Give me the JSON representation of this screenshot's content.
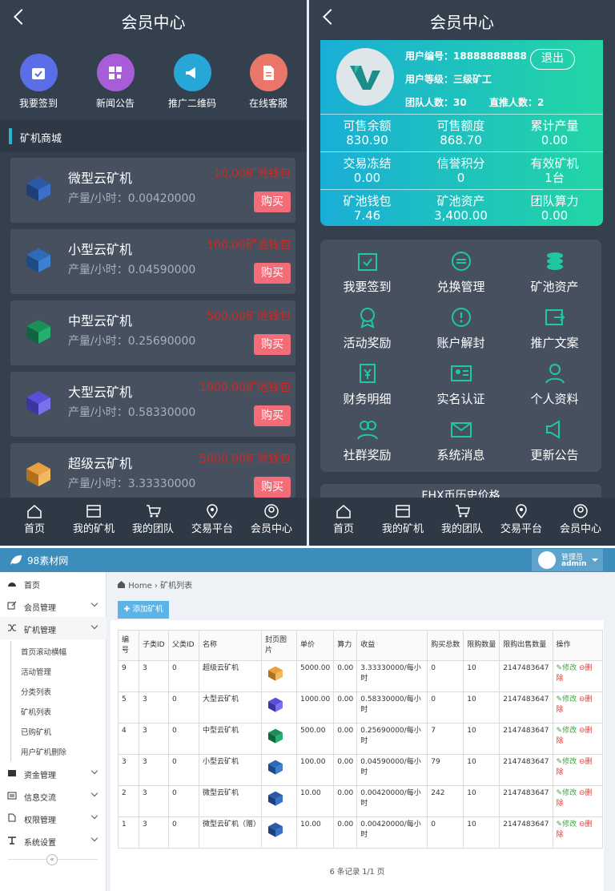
{
  "phone_left": {
    "header": {
      "title": "会员中心"
    },
    "quick": [
      {
        "label": "我要签到",
        "color": "#5a6ee8"
      },
      {
        "label": "新闻公告",
        "color": "#a85dd8"
      },
      {
        "label": "推广二维码",
        "color": "#27a6d8"
      },
      {
        "label": "在线客服",
        "color": "#e8776a"
      }
    ],
    "shop_title": "矿机商城",
    "products": [
      {
        "name": "微型云矿机",
        "output": "产量/小时：0.00420000",
        "price": "10.00矿池钱包",
        "buy": "购买",
        "color": "#2d5aa8"
      },
      {
        "name": "小型云矿机",
        "output": "产量/小时：0.04590000",
        "price": "100.00矿池钱包",
        "buy": "购买",
        "color": "#2d6ab8"
      },
      {
        "name": "中型云矿机",
        "output": "产量/小时：0.25690000",
        "price": "500.00矿池钱包",
        "buy": "购买",
        "color": "#1a8f5a"
      },
      {
        "name": "大型云矿机",
        "output": "产量/小时：0.58330000",
        "price": "1000.00矿池钱包",
        "buy": "购买",
        "color": "#5a50d8"
      },
      {
        "name": "超级云矿机",
        "output": "产量/小时：3.33330000",
        "price": "5000.00矿池钱包",
        "buy": "购买",
        "color": "#d8902a"
      }
    ]
  },
  "tabs": [
    "首页",
    "我的矿机",
    "我的团队",
    "交易平台",
    "会员中心"
  ],
  "phone_right": {
    "header": {
      "title": "会员中心"
    },
    "user_id": "用户编号：18888888888",
    "level": "用户等级：三级矿工",
    "team": "团队人数：30",
    "direct": "直推人数：2",
    "logout": "退出",
    "stats": [
      {
        "label": "可售余额",
        "value": "830.90"
      },
      {
        "label": "可售额度",
        "value": "868.70"
      },
      {
        "label": "累计产量",
        "value": "0.00"
      },
      {
        "label": "交易冻结",
        "value": "0.00"
      },
      {
        "label": "信誉积分",
        "value": "0"
      },
      {
        "label": "有效矿机",
        "value": "1台"
      },
      {
        "label": "矿池钱包",
        "value": "7.46"
      },
      {
        "label": "矿池资产",
        "value": "3,400.00"
      },
      {
        "label": "团队算力",
        "value": "0.00"
      }
    ],
    "menu": [
      "我要签到",
      "兑换管理",
      "矿池资产",
      "活动奖励",
      "账户解封",
      "推广文案",
      "财务明细",
      "实名认证",
      "个人资料",
      "社群奖励",
      "系统消息",
      "更新公告"
    ],
    "price_title": "FHX币历史价格"
  },
  "admin": {
    "brand": "98素材网",
    "role": "管理员",
    "username": "admin",
    "sidebar": [
      {
        "label": "首页",
        "chev": false
      },
      {
        "label": "会员管理",
        "chev": true
      },
      {
        "label": "矿机管理",
        "chev": true,
        "active": true
      },
      {
        "label": "资金管理",
        "chev": true
      },
      {
        "label": "信息交流",
        "chev": true
      },
      {
        "label": "权限管理",
        "chev": true
      },
      {
        "label": "系统设置",
        "chev": true
      }
    ],
    "submenu": [
      "首页滚动横幅",
      "活动管理",
      "分类列表",
      "矿机列表",
      "已购矿机",
      "用户矿机删除"
    ],
    "collapse": "«",
    "breadcrumb": {
      "home": "Home",
      "sep": "›",
      "current": "矿机列表"
    },
    "add_button": "✚ 添加矿机",
    "columns": [
      "编号",
      "子类ID",
      "父类ID",
      "名称",
      "封页图片",
      "单价",
      "算力",
      "收益",
      "购买总数",
      "限购数量",
      "限购出售数量",
      "操作"
    ],
    "rows": [
      {
        "id": "9",
        "sub": "3",
        "parent": "0",
        "name": "超级云矿机",
        "price": "5000.00",
        "power": "0.00",
        "income": "3.33330000/每小时",
        "bought": "0",
        "limit": "10",
        "limit_sell": "2147483647",
        "color": "#d8902a"
      },
      {
        "id": "5",
        "sub": "3",
        "parent": "0",
        "name": "大型云矿机",
        "price": "1000.00",
        "power": "0.00",
        "income": "0.58330000/每小时",
        "bought": "0",
        "limit": "10",
        "limit_sell": "2147483647",
        "color": "#5a50d8"
      },
      {
        "id": "4",
        "sub": "3",
        "parent": "0",
        "name": "中型云矿机",
        "price": "500.00",
        "power": "0.00",
        "income": "0.25690000/每小时",
        "bought": "7",
        "limit": "10",
        "limit_sell": "2147483647",
        "color": "#1a8f5a"
      },
      {
        "id": "3",
        "sub": "3",
        "parent": "0",
        "name": "小型云矿机",
        "price": "100.00",
        "power": "0.00",
        "income": "0.04590000/每小时",
        "bought": "79",
        "limit": "10",
        "limit_sell": "2147483647",
        "color": "#2d6ab8"
      },
      {
        "id": "2",
        "sub": "3",
        "parent": "0",
        "name": "微型云矿机",
        "price": "10.00",
        "power": "0.00",
        "income": "0.00420000/每小时",
        "bought": "242",
        "limit": "10",
        "limit_sell": "2147483647",
        "color": "#2d5aa8"
      },
      {
        "id": "1",
        "sub": "3",
        "parent": "0",
        "name": "微型云矿机（赠）",
        "price": "10.00",
        "power": "0.00",
        "income": "0.00420000/每小时",
        "bought": "0",
        "limit": "10",
        "limit_sell": "2147483647",
        "color": "#2d5aa8"
      }
    ],
    "edit_label": "修改",
    "delete_label": "删除",
    "footer": "6 条记录 1/1 页"
  }
}
